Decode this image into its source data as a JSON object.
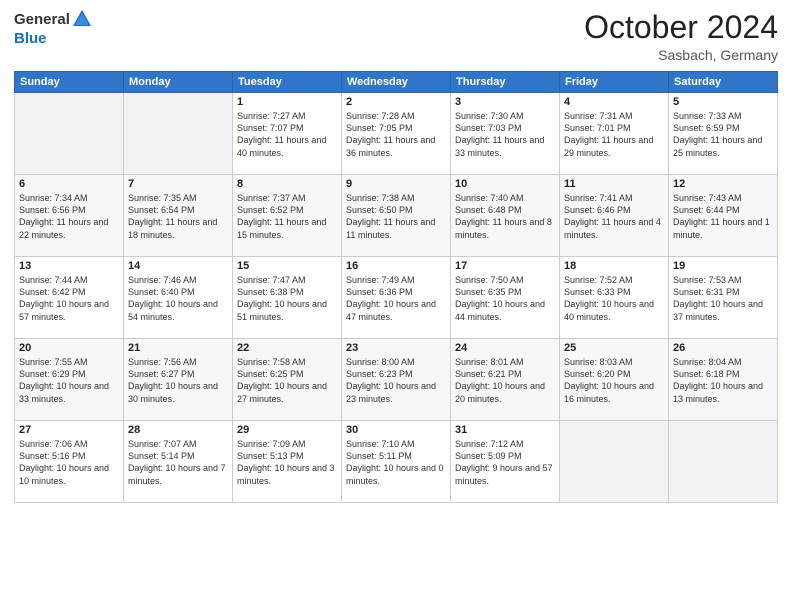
{
  "header": {
    "logo_general": "General",
    "logo_blue": "Blue",
    "month": "October 2024",
    "location": "Sasbach, Germany"
  },
  "days_of_week": [
    "Sunday",
    "Monday",
    "Tuesday",
    "Wednesday",
    "Thursday",
    "Friday",
    "Saturday"
  ],
  "weeks": [
    [
      {
        "day": "",
        "sunrise": "",
        "sunset": "",
        "daylight": ""
      },
      {
        "day": "",
        "sunrise": "",
        "sunset": "",
        "daylight": ""
      },
      {
        "day": "1",
        "sunrise": "Sunrise: 7:27 AM",
        "sunset": "Sunset: 7:07 PM",
        "daylight": "Daylight: 11 hours and 40 minutes."
      },
      {
        "day": "2",
        "sunrise": "Sunrise: 7:28 AM",
        "sunset": "Sunset: 7:05 PM",
        "daylight": "Daylight: 11 hours and 36 minutes."
      },
      {
        "day": "3",
        "sunrise": "Sunrise: 7:30 AM",
        "sunset": "Sunset: 7:03 PM",
        "daylight": "Daylight: 11 hours and 33 minutes."
      },
      {
        "day": "4",
        "sunrise": "Sunrise: 7:31 AM",
        "sunset": "Sunset: 7:01 PM",
        "daylight": "Daylight: 11 hours and 29 minutes."
      },
      {
        "day": "5",
        "sunrise": "Sunrise: 7:33 AM",
        "sunset": "Sunset: 6:59 PM",
        "daylight": "Daylight: 11 hours and 25 minutes."
      }
    ],
    [
      {
        "day": "6",
        "sunrise": "Sunrise: 7:34 AM",
        "sunset": "Sunset: 6:56 PM",
        "daylight": "Daylight: 11 hours and 22 minutes."
      },
      {
        "day": "7",
        "sunrise": "Sunrise: 7:35 AM",
        "sunset": "Sunset: 6:54 PM",
        "daylight": "Daylight: 11 hours and 18 minutes."
      },
      {
        "day": "8",
        "sunrise": "Sunrise: 7:37 AM",
        "sunset": "Sunset: 6:52 PM",
        "daylight": "Daylight: 11 hours and 15 minutes."
      },
      {
        "day": "9",
        "sunrise": "Sunrise: 7:38 AM",
        "sunset": "Sunset: 6:50 PM",
        "daylight": "Daylight: 11 hours and 11 minutes."
      },
      {
        "day": "10",
        "sunrise": "Sunrise: 7:40 AM",
        "sunset": "Sunset: 6:48 PM",
        "daylight": "Daylight: 11 hours and 8 minutes."
      },
      {
        "day": "11",
        "sunrise": "Sunrise: 7:41 AM",
        "sunset": "Sunset: 6:46 PM",
        "daylight": "Daylight: 11 hours and 4 minutes."
      },
      {
        "day": "12",
        "sunrise": "Sunrise: 7:43 AM",
        "sunset": "Sunset: 6:44 PM",
        "daylight": "Daylight: 11 hours and 1 minute."
      }
    ],
    [
      {
        "day": "13",
        "sunrise": "Sunrise: 7:44 AM",
        "sunset": "Sunset: 6:42 PM",
        "daylight": "Daylight: 10 hours and 57 minutes."
      },
      {
        "day": "14",
        "sunrise": "Sunrise: 7:46 AM",
        "sunset": "Sunset: 6:40 PM",
        "daylight": "Daylight: 10 hours and 54 minutes."
      },
      {
        "day": "15",
        "sunrise": "Sunrise: 7:47 AM",
        "sunset": "Sunset: 6:38 PM",
        "daylight": "Daylight: 10 hours and 51 minutes."
      },
      {
        "day": "16",
        "sunrise": "Sunrise: 7:49 AM",
        "sunset": "Sunset: 6:36 PM",
        "daylight": "Daylight: 10 hours and 47 minutes."
      },
      {
        "day": "17",
        "sunrise": "Sunrise: 7:50 AM",
        "sunset": "Sunset: 6:35 PM",
        "daylight": "Daylight: 10 hours and 44 minutes."
      },
      {
        "day": "18",
        "sunrise": "Sunrise: 7:52 AM",
        "sunset": "Sunset: 6:33 PM",
        "daylight": "Daylight: 10 hours and 40 minutes."
      },
      {
        "day": "19",
        "sunrise": "Sunrise: 7:53 AM",
        "sunset": "Sunset: 6:31 PM",
        "daylight": "Daylight: 10 hours and 37 minutes."
      }
    ],
    [
      {
        "day": "20",
        "sunrise": "Sunrise: 7:55 AM",
        "sunset": "Sunset: 6:29 PM",
        "daylight": "Daylight: 10 hours and 33 minutes."
      },
      {
        "day": "21",
        "sunrise": "Sunrise: 7:56 AM",
        "sunset": "Sunset: 6:27 PM",
        "daylight": "Daylight: 10 hours and 30 minutes."
      },
      {
        "day": "22",
        "sunrise": "Sunrise: 7:58 AM",
        "sunset": "Sunset: 6:25 PM",
        "daylight": "Daylight: 10 hours and 27 minutes."
      },
      {
        "day": "23",
        "sunrise": "Sunrise: 8:00 AM",
        "sunset": "Sunset: 6:23 PM",
        "daylight": "Daylight: 10 hours and 23 minutes."
      },
      {
        "day": "24",
        "sunrise": "Sunrise: 8:01 AM",
        "sunset": "Sunset: 6:21 PM",
        "daylight": "Daylight: 10 hours and 20 minutes."
      },
      {
        "day": "25",
        "sunrise": "Sunrise: 8:03 AM",
        "sunset": "Sunset: 6:20 PM",
        "daylight": "Daylight: 10 hours and 16 minutes."
      },
      {
        "day": "26",
        "sunrise": "Sunrise: 8:04 AM",
        "sunset": "Sunset: 6:18 PM",
        "daylight": "Daylight: 10 hours and 13 minutes."
      }
    ],
    [
      {
        "day": "27",
        "sunrise": "Sunrise: 7:06 AM",
        "sunset": "Sunset: 5:16 PM",
        "daylight": "Daylight: 10 hours and 10 minutes."
      },
      {
        "day": "28",
        "sunrise": "Sunrise: 7:07 AM",
        "sunset": "Sunset: 5:14 PM",
        "daylight": "Daylight: 10 hours and 7 minutes."
      },
      {
        "day": "29",
        "sunrise": "Sunrise: 7:09 AM",
        "sunset": "Sunset: 5:13 PM",
        "daylight": "Daylight: 10 hours and 3 minutes."
      },
      {
        "day": "30",
        "sunrise": "Sunrise: 7:10 AM",
        "sunset": "Sunset: 5:11 PM",
        "daylight": "Daylight: 10 hours and 0 minutes."
      },
      {
        "day": "31",
        "sunrise": "Sunrise: 7:12 AM",
        "sunset": "Sunset: 5:09 PM",
        "daylight": "Daylight: 9 hours and 57 minutes."
      },
      {
        "day": "",
        "sunrise": "",
        "sunset": "",
        "daylight": ""
      },
      {
        "day": "",
        "sunrise": "",
        "sunset": "",
        "daylight": ""
      }
    ]
  ]
}
